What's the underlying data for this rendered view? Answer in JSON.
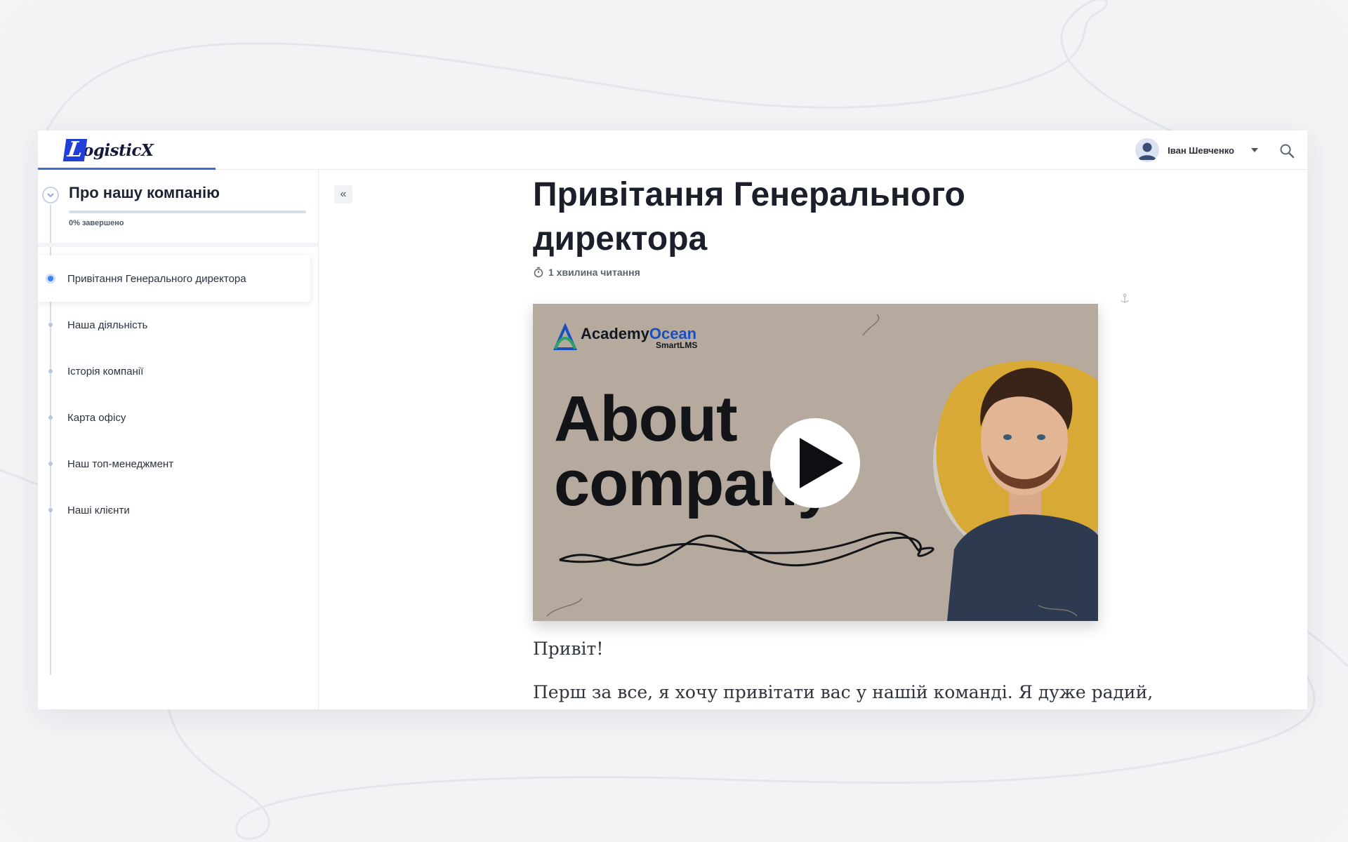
{
  "header": {
    "logo_initial": "L",
    "logo_text": "ogisticX",
    "user_name": "Іван Шевченко"
  },
  "sidebar": {
    "course_title": "Про нашу компанію",
    "progress_text": "0% завершено",
    "progress_value": 0,
    "lessons": [
      {
        "label": "Привітання Генерального директора",
        "active": true
      },
      {
        "label": "Наша діяльність",
        "active": false
      },
      {
        "label": "Історія компанії",
        "active": false
      },
      {
        "label": "Карта офісу",
        "active": false
      },
      {
        "label": "Наш топ-менеджмент",
        "active": false
      },
      {
        "label": "Наші клієнти",
        "active": false
      }
    ]
  },
  "main": {
    "collapse_label": "«",
    "title_line1": "Привітання Генерального",
    "title_line2": "директора",
    "reading_time": "1 хвилина читання",
    "video": {
      "brand_academy": "Academy",
      "brand_ocean": "Ocean",
      "brand_smart": "Smart",
      "brand_lms": "LMS",
      "title_line1": "About",
      "title_line2": "company"
    },
    "paragraph1": "Привіт!",
    "paragraph2": "Перш за все, я хочу привітати вас у нашій команді. Я дуже радий,"
  },
  "colors": {
    "accent": "#3b6fd6",
    "logo_blue": "#1f3fd6",
    "video_bg": "#b5aa9d",
    "blob_yellow": "#d8a935"
  }
}
